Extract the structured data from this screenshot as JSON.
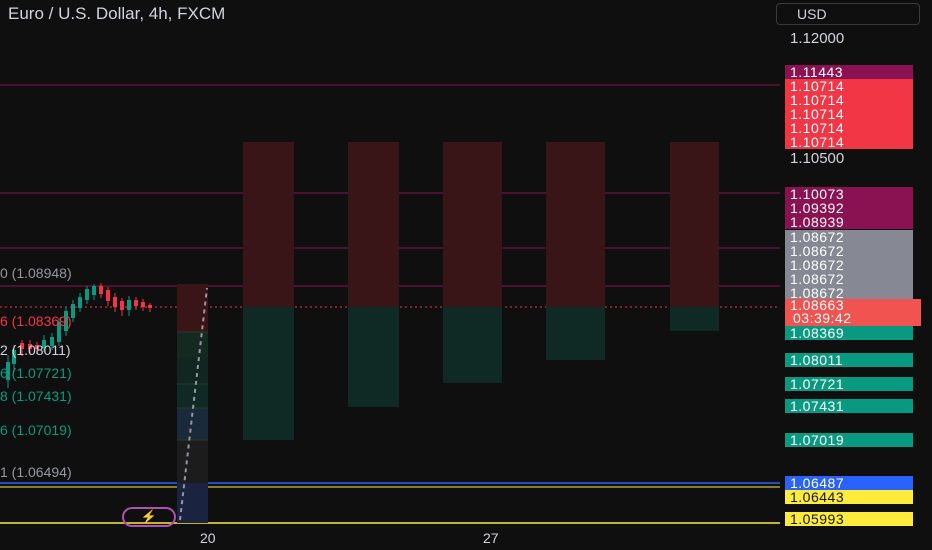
{
  "header": {
    "title": "Euro / U.S. Dollar, 4h, FXCM",
    "currency": "USD"
  },
  "price_axis": {
    "labels": [
      "1.12000",
      "1.10500"
    ]
  },
  "badges": [
    {
      "value": "1.11443",
      "color": "#8a1152"
    },
    {
      "value": "1.10714",
      "color": "#f23645"
    },
    {
      "value": "1.10714",
      "color": "#f23645"
    },
    {
      "value": "1.10714",
      "color": "#f23645"
    },
    {
      "value": "1.10714",
      "color": "#f23645"
    },
    {
      "value": "1.10714",
      "color": "#f23645"
    },
    {
      "value": "1.10073",
      "color": "#8a1152"
    },
    {
      "value": "1.09392",
      "color": "#8a1152"
    },
    {
      "value": "1.08939",
      "color": "#8a1152"
    },
    {
      "value": "1.08672",
      "color": "#868993"
    },
    {
      "value": "1.08672",
      "color": "#868993"
    },
    {
      "value": "1.08672",
      "color": "#868993"
    },
    {
      "value": "1.08672",
      "color": "#868993"
    },
    {
      "value": "1.08672",
      "color": "#868993"
    },
    {
      "value": "1.08369",
      "color": "#089981"
    },
    {
      "value": "1.08011",
      "color": "#089981"
    },
    {
      "value": "1.07721",
      "color": "#089981"
    },
    {
      "value": "1.07431",
      "color": "#089981"
    },
    {
      "value": "1.07019",
      "color": "#089981"
    },
    {
      "value": "1.06487",
      "color": "#2962ff"
    },
    {
      "value": "1.06443",
      "color": "#ffeb3b"
    },
    {
      "value": "1.05993",
      "color": "#ffeb3b"
    }
  ],
  "current_price": {
    "value": "1.08663",
    "countdown": "03:39:42"
  },
  "level_labels": [
    {
      "text": "0 (1.08948)",
      "color": "#9598a1"
    },
    {
      "text": "6 (1.08369)",
      "color": "#f23645"
    },
    {
      "text": "2 (1.08011)",
      "color": "#d1d4dc"
    },
    {
      "text": "6 (1.07721)",
      "color": "#089981"
    },
    {
      "text": "8 (1.07431)",
      "color": "#089981"
    },
    {
      "text": "6 (1.07019)",
      "color": "#089981"
    },
    {
      "text": "1 (1.06494)",
      "color": "#9598a1"
    }
  ],
  "time_axis": {
    "labels": [
      "20",
      "27"
    ]
  },
  "colors": {
    "background": "#0f0f0f",
    "bear_zone": "#3a1518",
    "bull_zone": "#0f2a24",
    "level_line": "#8a1152",
    "blue_line": "#2962ff",
    "yellow_line": "#ffeb3b",
    "candle_up": "#089981",
    "candle_down": "#f23645"
  }
}
